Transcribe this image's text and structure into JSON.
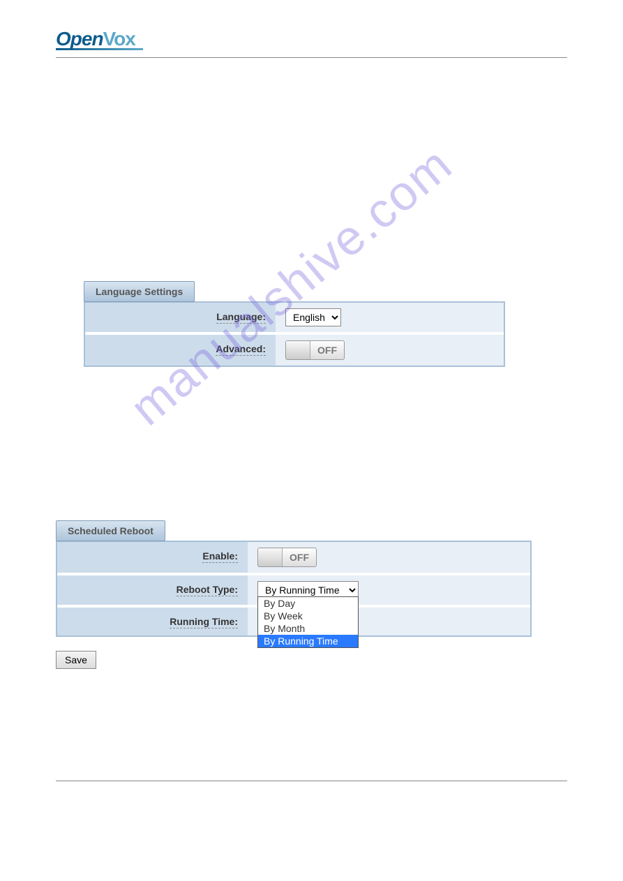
{
  "logo": {
    "part1": "Open",
    "part2": "Vox"
  },
  "watermark": "manualshive.com",
  "language_settings": {
    "title": "Language Settings",
    "language_label": "Language:",
    "language_value": "English",
    "advanced_label": "Advanced:",
    "advanced_state": "OFF"
  },
  "scheduled_reboot": {
    "title": "Scheduled Reboot",
    "enable_label": "Enable:",
    "enable_state": "OFF",
    "reboot_type_label": "Reboot Type:",
    "reboot_type_value": "By Running Time",
    "running_time_label": "Running Time:",
    "options": [
      "By Day",
      "By Week",
      "By Month",
      "By Running Time"
    ],
    "selected_option": "By Running Time"
  },
  "buttons": {
    "save": "Save"
  }
}
